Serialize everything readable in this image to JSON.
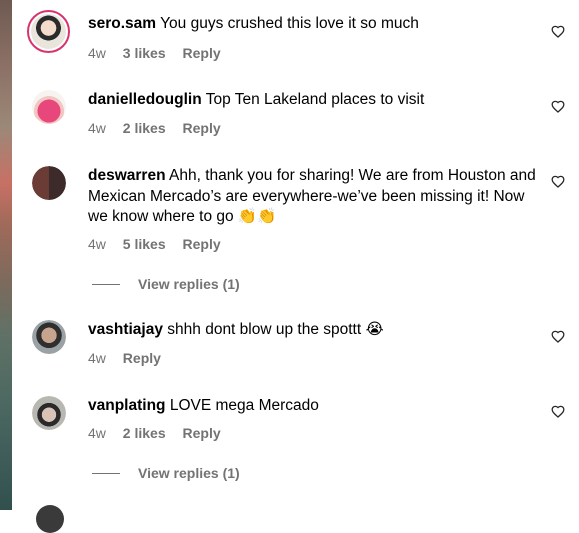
{
  "comments": [
    {
      "username": "sero.sam",
      "text": "You guys crushed this love it so much",
      "time": "4w",
      "likes": "3 likes",
      "reply": "Reply"
    },
    {
      "username": "danielledouglin",
      "text": "Top Ten Lakeland places to visit",
      "time": "4w",
      "likes": "2 likes",
      "reply": "Reply"
    },
    {
      "username": "deswarren",
      "text": "Ahh, thank you for sharing! We are from Houston and Mexican Mercado’s are everywhere-we’ve been missing it! Now we know where to go 👏👏",
      "time": "4w",
      "likes": "5 likes",
      "reply": "Reply"
    },
    {
      "username": "vashtiajay",
      "text": "shhh dont blow up the spottt 😭",
      "time": "4w",
      "likes": "",
      "reply": "Reply"
    },
    {
      "username": "vanplating",
      "text": "LOVE mega Mercado",
      "time": "4w",
      "likes": "2 likes",
      "reply": "Reply"
    }
  ],
  "view_replies": [
    "View replies (1)",
    "View replies (1)"
  ],
  "icons": {
    "like": "heart-outline-icon"
  },
  "colors": {
    "meta": "#737373",
    "ring": "#d9336f"
  }
}
